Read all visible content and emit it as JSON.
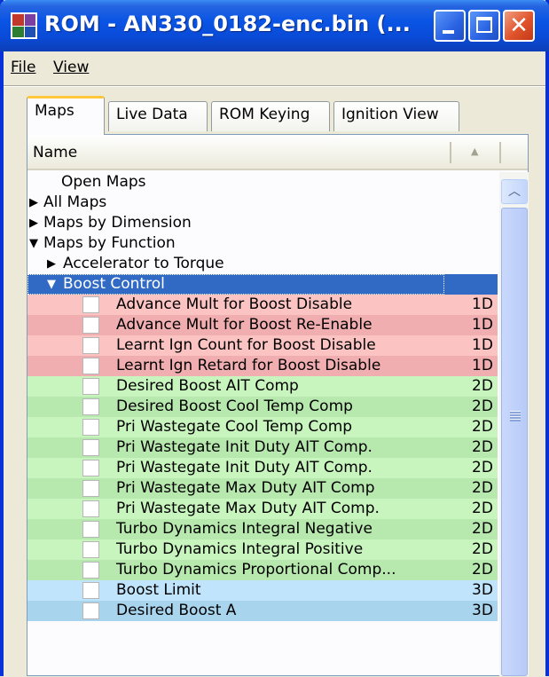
{
  "window": {
    "title": "ROM - AN330_0182-enc.bin (..."
  },
  "menu": {
    "file": "File",
    "view": "View"
  },
  "tabs": [
    "Maps",
    "Live Data",
    "ROM Keying",
    "Ignition View"
  ],
  "table": {
    "header": "Name"
  },
  "tree": {
    "open_maps": "Open Maps",
    "all_maps": "All Maps",
    "maps_by_dimension": "Maps by Dimension",
    "maps_by_function": "Maps by Function",
    "accel_to_torque": "Accelerator to Torque",
    "boost_control": "Boost Control",
    "maps": [
      {
        "name": "Advance Mult for Boost Disable",
        "dim": "1D"
      },
      {
        "name": "Advance Mult for Boost Re-Enable",
        "dim": "1D"
      },
      {
        "name": "Learnt Ign Count for Boost Disable",
        "dim": "1D"
      },
      {
        "name": "Learnt Ign Retard for Boost Disable",
        "dim": "1D"
      },
      {
        "name": "Desired Boost AIT Comp",
        "dim": "2D"
      },
      {
        "name": "Desired Boost Cool Temp Comp",
        "dim": "2D"
      },
      {
        "name": "Pri Wastegate Cool Temp Comp",
        "dim": "2D"
      },
      {
        "name": "Pri Wastegate Init Duty AIT Comp.",
        "dim": "2D"
      },
      {
        "name": "Pri Wastegate Init Duty AIT Comp.",
        "dim": "2D"
      },
      {
        "name": "Pri Wastegate Max Duty AIT Comp",
        "dim": "2D"
      },
      {
        "name": "Pri Wastegate Max Duty AIT Comp.",
        "dim": "2D"
      },
      {
        "name": "Turbo Dynamics Integral Negative",
        "dim": "2D"
      },
      {
        "name": "Turbo Dynamics Integral Positive",
        "dim": "2D"
      },
      {
        "name": "Turbo Dynamics Proportional Comp...",
        "dim": "2D"
      },
      {
        "name": "Boost Limit",
        "dim": "3D"
      },
      {
        "name": "Desired Boost A",
        "dim": "3D"
      }
    ]
  },
  "colors": {
    "1D_a": "#fcc3c3",
    "1D_b": "#f1aeb0",
    "2D_a": "#c8f5be",
    "2D_b": "#b7e8ad",
    "3D_a": "#bfe4fb",
    "3D_b": "#a9d4ee",
    "selection": "#316ac5"
  }
}
